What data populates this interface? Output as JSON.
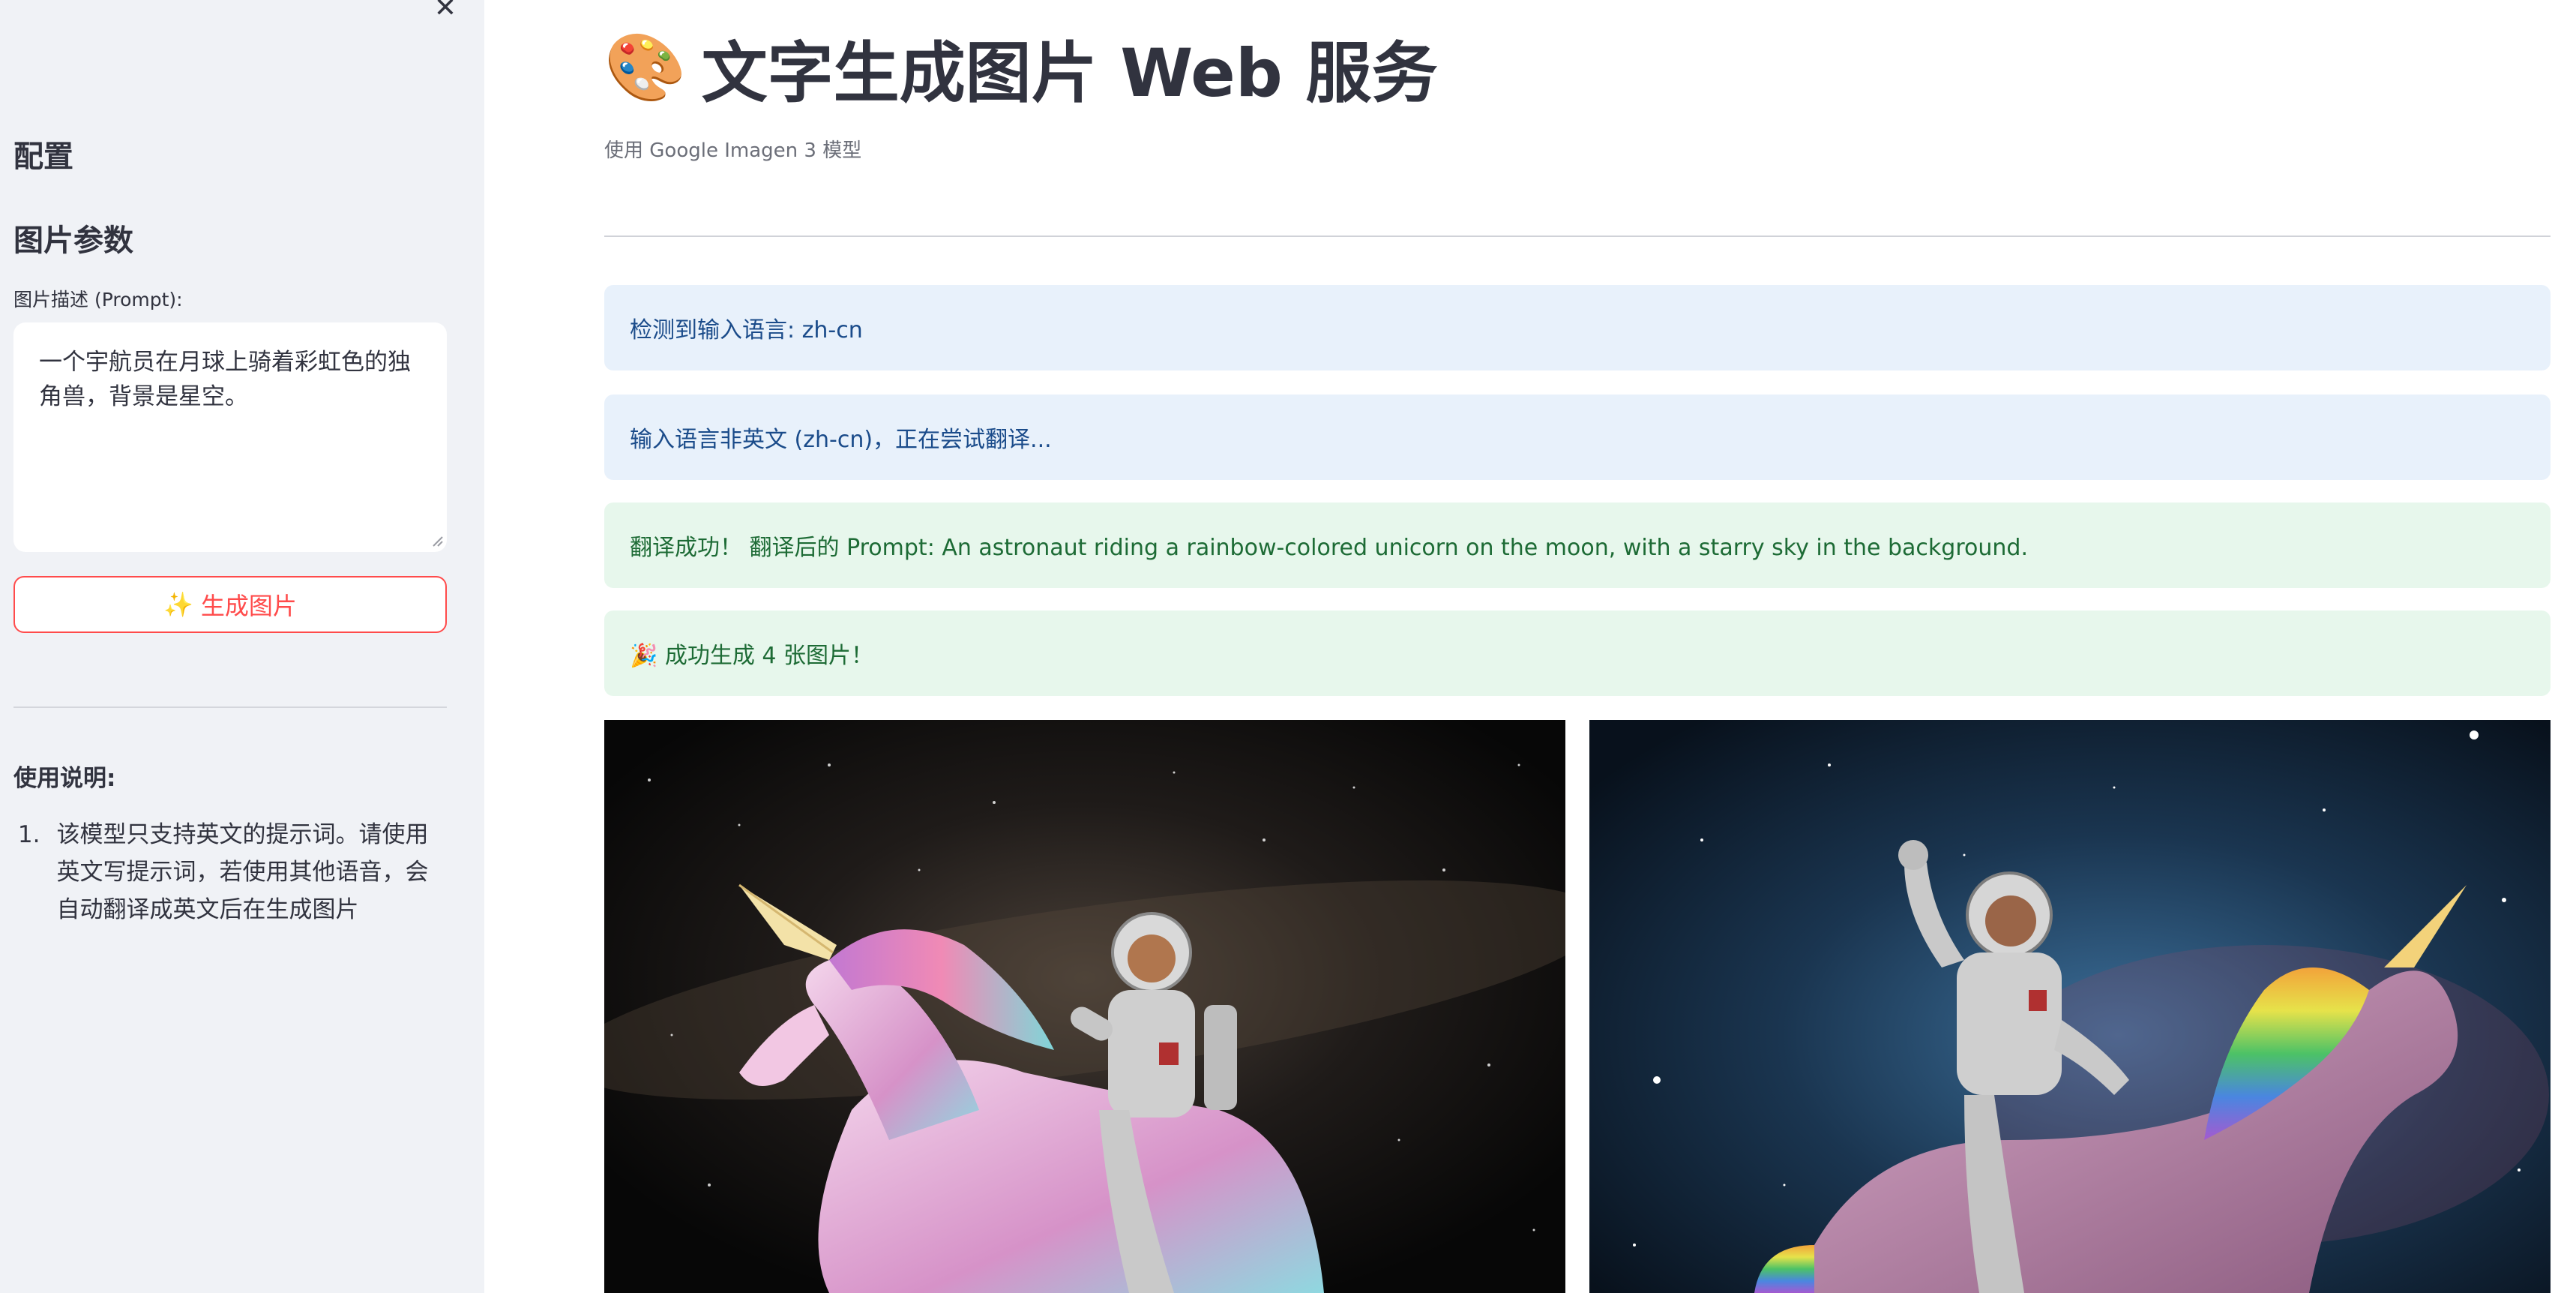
{
  "sidebar": {
    "close_symbol": "✕",
    "config_heading": "配置",
    "params_heading": "图片参数",
    "prompt_label": "图片描述 (Prompt):",
    "prompt_value": "一个宇航员在月球上骑着彩虹色的独角兽，背景是星空。",
    "generate_icon": "✨",
    "generate_label": "生成图片",
    "usage_title": "使用说明:",
    "usage_items": [
      {
        "num": "1.",
        "text": "该模型只支持英文的提示词。请使用英文写提示词，若使用其他语音，会自动翻译成英文后在生成图片"
      }
    ]
  },
  "main": {
    "title_icon": "🎨",
    "title": "文字生成图片 Web 服务",
    "subtitle": "使用 Google Imagen 3 模型",
    "alerts": [
      {
        "type": "info",
        "text": "检测到输入语言: zh-cn"
      },
      {
        "type": "info",
        "text": "输入语言非英文 (zh-cn)，正在尝试翻译..."
      },
      {
        "type": "success",
        "text": "翻译成功！ 翻译后的 Prompt: An astronaut riding a rainbow-colored unicorn on the moon, with a starry sky in the background."
      },
      {
        "type": "success",
        "text": "🎉 成功生成 4 张图片！"
      }
    ],
    "images": [
      {
        "alt": "astronaut-unicorn-image-1"
      },
      {
        "alt": "astronaut-unicorn-image-2"
      }
    ]
  },
  "colors": {
    "accent": "#ff4b4b",
    "sidebar_bg": "#f0f2f6",
    "info_bg": "#e8f1fb",
    "info_text": "#1a4b8a",
    "success_bg": "#e7f7ec",
    "success_text": "#1d6b35"
  }
}
